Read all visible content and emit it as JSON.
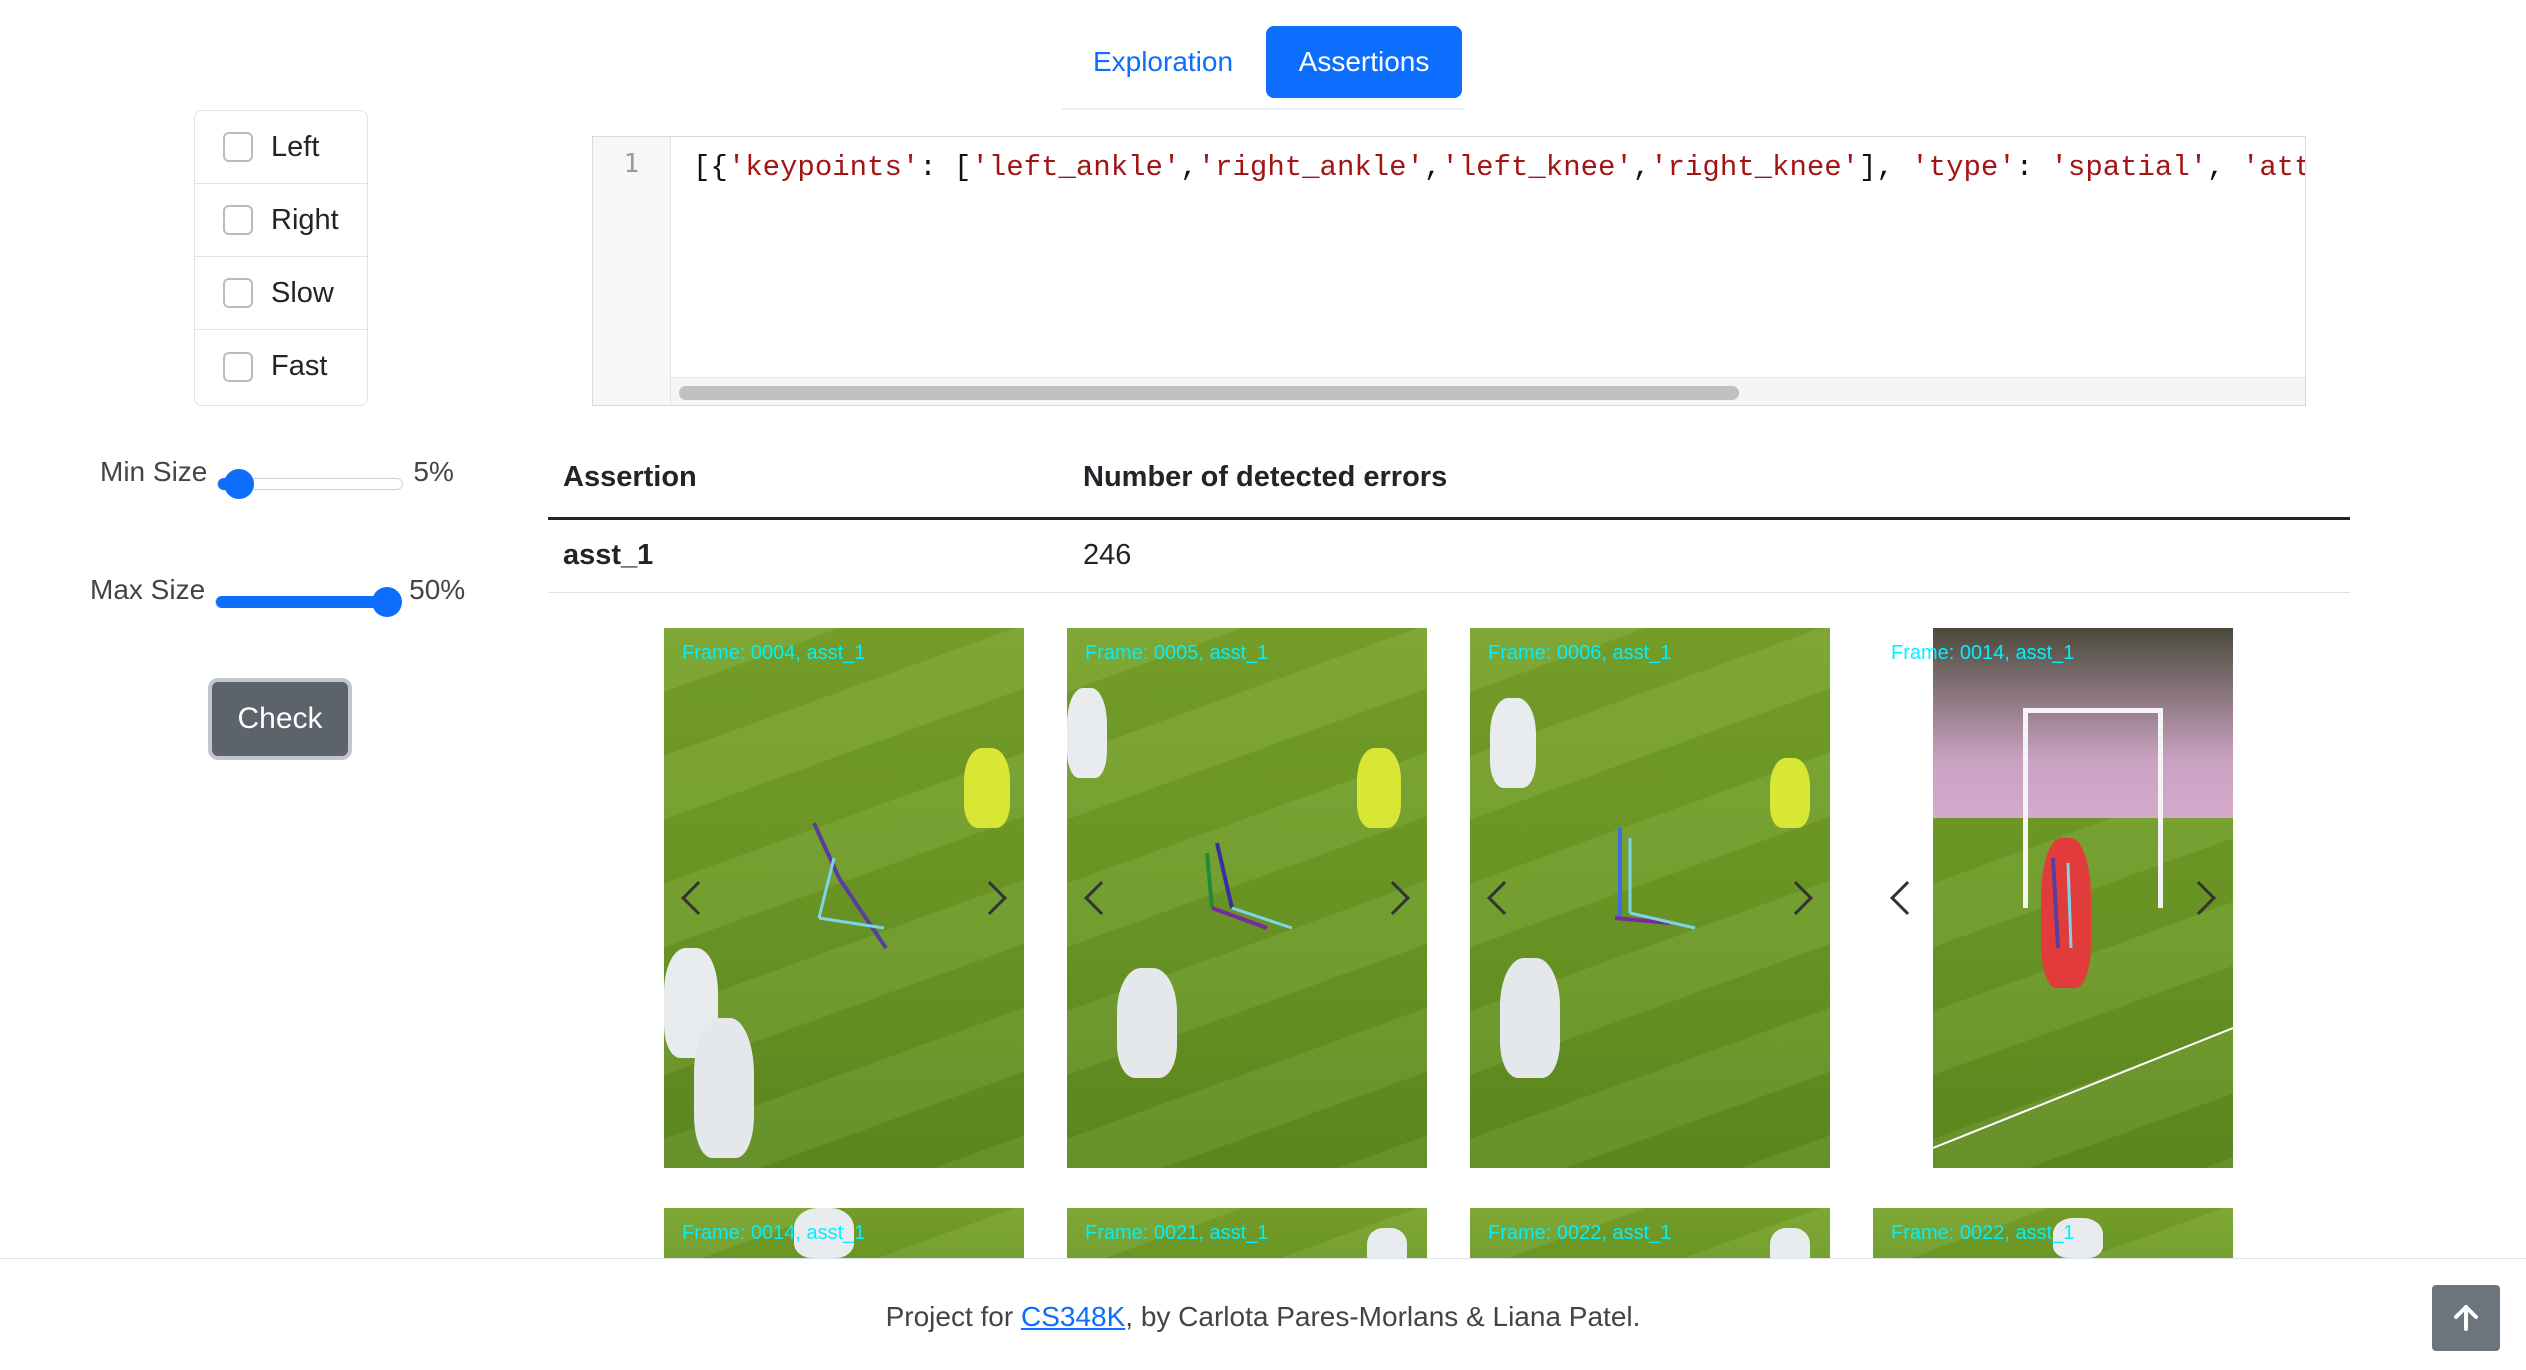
{
  "tabs": {
    "exploration": "Exploration",
    "assertions": "Assertions",
    "active": "assertions"
  },
  "filters": {
    "checkboxes": [
      {
        "label": "Left",
        "checked": false
      },
      {
        "label": "Right",
        "checked": false
      },
      {
        "label": "Slow",
        "checked": false
      },
      {
        "label": "Fast",
        "checked": false
      }
    ],
    "min_size": {
      "label": "Min Size",
      "value_text": "5%",
      "value": 5
    },
    "max_size": {
      "label": "Max Size",
      "value_text": "50%",
      "value": 50
    },
    "check_button": "Check"
  },
  "editor": {
    "line_number": "1",
    "code_tokens": {
      "t0": "[{",
      "t1": "'keypoints'",
      "t2": ": [",
      "t3": "'left_ankle'",
      "t4": ",",
      "t5": "'right_ankle'",
      "t6": ",",
      "t7": "'left_knee'",
      "t8": ",",
      "t9": "'right_knee'",
      "t10": "], ",
      "t11": "'type'",
      "t12": ": ",
      "t13": "'spatial'",
      "t14": ", ",
      "t15": "'att:"
    }
  },
  "results": {
    "headers": [
      "Assertion",
      "Number of detected errors"
    ],
    "rows": [
      {
        "assertion": "asst_1",
        "errors": "246"
      }
    ]
  },
  "gallery": {
    "row1": [
      {
        "label": "Frame: 0004, asst_1"
      },
      {
        "label": "Frame: 0005, asst_1"
      },
      {
        "label": "Frame: 0006, asst_1"
      },
      {
        "label": "Frame: 0014, asst_1"
      }
    ],
    "row2": [
      {
        "label": "Frame: 0014, asst_1"
      },
      {
        "label": "Frame: 0021, asst_1"
      },
      {
        "label": "Frame: 0022, asst_1"
      },
      {
        "label": "Frame: 0022, asst_1"
      }
    ]
  },
  "footer": {
    "prefix": "Project for ",
    "link": "CS348K",
    "suffix": ", by Carlota Pares-Morlans & Liana Patel."
  },
  "colors": {
    "primary": "#0d6efd",
    "secondary": "#5c636a",
    "frame_label": "#00f0ff"
  }
}
